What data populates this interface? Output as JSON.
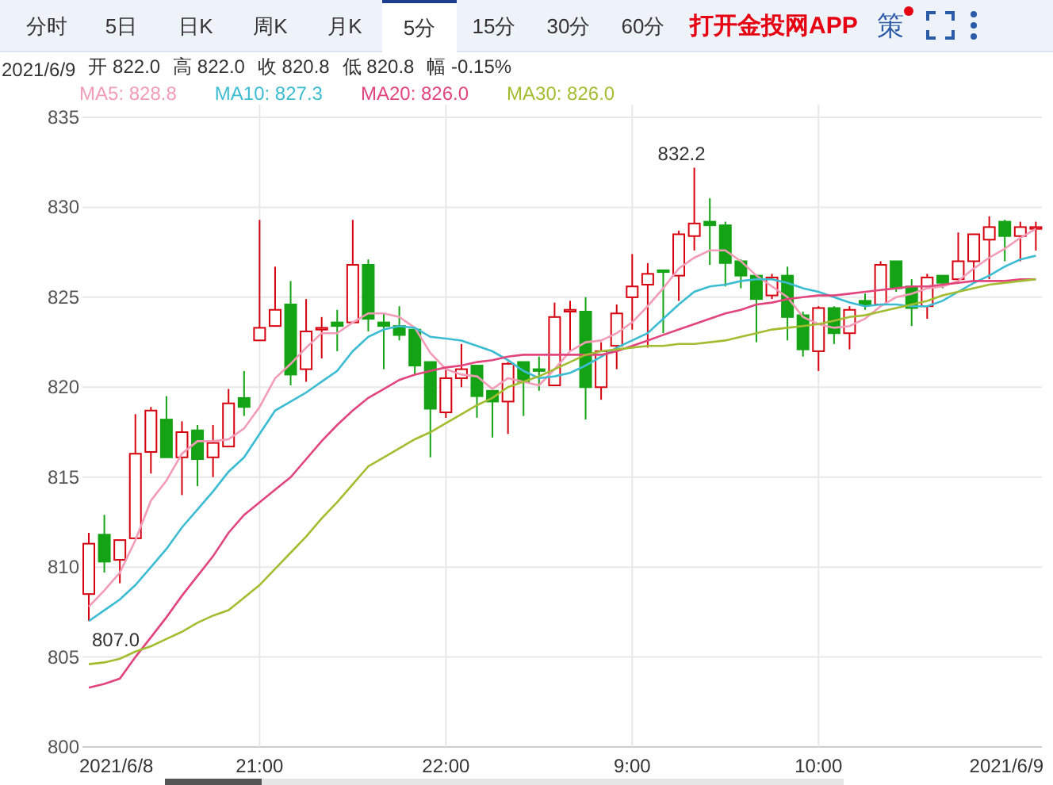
{
  "tabs": [
    {
      "label": "分时",
      "selected": false
    },
    {
      "label": "5日",
      "selected": false
    },
    {
      "label": "日K",
      "selected": false
    },
    {
      "label": "周K",
      "selected": false
    },
    {
      "label": "月K",
      "selected": false
    },
    {
      "label": "5分",
      "selected": true
    },
    {
      "label": "15分",
      "selected": false
    },
    {
      "label": "30分",
      "selected": false
    },
    {
      "label": "60分",
      "selected": false
    }
  ],
  "promo_link": "打开金投网APP",
  "strategy_button": {
    "label": "策",
    "has_alert": true
  },
  "quote_info": [
    "2021/6/9",
    "开 822.0",
    "高 822.0",
    "收 820.8",
    "低 820.8",
    "幅 -0.15%"
  ],
  "legend_values": [
    ": 828.8",
    ": 827.3",
    ": 826.0",
    ": 826.0"
  ],
  "axis_dates": [
    "2021/6/8",
    "2021/6/9"
  ],
  "chart_data": {
    "type": "candlestick",
    "grid": true,
    "categories": [
      null,
      null,
      null,
      null,
      null,
      null,
      null,
      null,
      null,
      null,
      null,
      "21:00",
      null,
      null,
      null,
      null,
      null,
      null,
      null,
      null,
      null,
      null,
      null,
      "22:00",
      null,
      null,
      null,
      null,
      null,
      null,
      null,
      null,
      null,
      null,
      null,
      "9:00",
      null,
      null,
      null,
      null,
      null,
      null,
      null,
      null,
      null,
      null,
      null,
      "10:00",
      null,
      null,
      null,
      null,
      null,
      null,
      null,
      null,
      null,
      null,
      null,
      null,
      null,
      null
    ],
    "ylim": [
      800,
      835
    ],
    "yticks": [
      800,
      805,
      810,
      815,
      820,
      825,
      830,
      835
    ],
    "annotations": [
      "832.2",
      "807.0"
    ],
    "ohlc": [
      [
        808.5,
        811.9,
        807.0,
        811.3
      ],
      [
        811.8,
        812.9,
        809.7,
        810.3
      ],
      [
        810.4,
        811.5,
        809.1,
        811.5
      ],
      [
        811.6,
        818.5,
        811.6,
        816.3
      ],
      [
        816.4,
        818.9,
        815.2,
        818.7
      ],
      [
        818.2,
        819.5,
        816.1,
        816.1
      ],
      [
        816.1,
        818.1,
        814.0,
        817.5
      ],
      [
        817.6,
        817.9,
        814.5,
        816.0
      ],
      [
        816.1,
        817.9,
        815.0,
        816.9
      ],
      [
        816.7,
        819.9,
        816.7,
        819.1
      ],
      [
        819.4,
        820.9,
        818.4,
        818.9
      ],
      [
        822.6,
        829.3,
        822.6,
        823.3
      ],
      [
        823.4,
        826.7,
        823.4,
        824.3
      ],
      [
        824.6,
        825.9,
        820.1,
        820.7
      ],
      [
        821.0,
        824.9,
        820.3,
        823.1
      ],
      [
        823.2,
        823.9,
        821.6,
        823.3
      ],
      [
        823.6,
        824.3,
        822.0,
        823.4
      ],
      [
        823.6,
        829.3,
        823.6,
        826.8
      ],
      [
        826.8,
        827.1,
        823.1,
        823.8
      ],
      [
        823.6,
        824.1,
        821.0,
        823.4
      ],
      [
        823.4,
        824.5,
        822.6,
        822.9
      ],
      [
        823.2,
        823.3,
        820.7,
        821.2
      ],
      [
        821.4,
        821.4,
        816.1,
        818.8
      ],
      [
        818.6,
        821.0,
        818.3,
        820.5
      ],
      [
        820.5,
        822.4,
        820.0,
        821.0
      ],
      [
        821.2,
        821.2,
        818.3,
        819.5
      ],
      [
        819.8,
        819.8,
        817.2,
        819.2
      ],
      [
        819.2,
        821.4,
        817.4,
        821.3
      ],
      [
        821.4,
        821.4,
        818.4,
        820.3
      ],
      [
        821.0,
        821.7,
        819.8,
        820.9
      ],
      [
        820.1,
        824.7,
        820.1,
        823.9
      ],
      [
        824.2,
        824.8,
        822.0,
        824.3
      ],
      [
        824.2,
        825.0,
        818.2,
        820.0
      ],
      [
        820.0,
        822.5,
        819.3,
        822.0
      ],
      [
        822.3,
        824.6,
        821.0,
        824.1
      ],
      [
        825.0,
        827.4,
        823.2,
        825.6
      ],
      [
        825.7,
        826.9,
        822.2,
        826.3
      ],
      [
        826.5,
        826.5,
        823.0,
        826.4
      ],
      [
        826.2,
        828.7,
        824.8,
        828.5
      ],
      [
        828.4,
        832.2,
        827.6,
        829.1
      ],
      [
        829.2,
        830.5,
        826.8,
        829.0
      ],
      [
        829.0,
        829.2,
        825.6,
        826.9
      ],
      [
        827.0,
        827.1,
        825.5,
        826.2
      ],
      [
        826.2,
        826.2,
        822.5,
        824.9
      ],
      [
        825.1,
        826.3,
        824.9,
        826.1
      ],
      [
        826.2,
        826.7,
        822.6,
        823.9
      ],
      [
        824.0,
        824.2,
        821.7,
        822.1
      ],
      [
        822.0,
        824.5,
        820.9,
        824.4
      ],
      [
        824.4,
        824.5,
        822.4,
        823.0
      ],
      [
        823.0,
        824.5,
        822.1,
        824.3
      ],
      [
        824.8,
        825.2,
        824.3,
        824.6
      ],
      [
        824.6,
        827.0,
        824.5,
        826.8
      ],
      [
        827.0,
        827.0,
        825.3,
        825.5
      ],
      [
        825.6,
        826.0,
        823.4,
        824.4
      ],
      [
        824.5,
        826.3,
        823.8,
        826.1
      ],
      [
        826.2,
        826.2,
        825.5,
        825.8
      ],
      [
        826.0,
        828.6,
        825.8,
        827.0
      ],
      [
        827.0,
        828.5,
        825.8,
        828.5
      ],
      [
        828.2,
        829.5,
        826.0,
        828.9
      ],
      [
        829.2,
        829.3,
        827.0,
        828.4
      ],
      [
        828.4,
        829.2,
        827.0,
        828.9
      ],
      [
        828.8,
        829.2,
        827.6,
        828.9
      ]
    ],
    "series": [
      {
        "name": "MA5",
        "type": "line",
        "color": "#f29cb7",
        "values": [
          807.8,
          808.7,
          809.7,
          811.5,
          813.7,
          814.8,
          816.3,
          817.0,
          817.0,
          817.1,
          817.7,
          818.9,
          820.5,
          821.3,
          822.2,
          823.0,
          823.0,
          823.6,
          824.1,
          824.1,
          823.9,
          823.3,
          821.9,
          821.0,
          820.7,
          820.6,
          819.9,
          820.5,
          820.3,
          820.1,
          821.0,
          822.0,
          822.5,
          822.6,
          823.0,
          823.6,
          824.5,
          825.5,
          826.6,
          827.2,
          827.6,
          827.6,
          827.0,
          826.2,
          825.6,
          825.0,
          823.9,
          823.5,
          823.3,
          823.4,
          823.8,
          824.5,
          825.0,
          825.2,
          825.5,
          825.6,
          825.9,
          826.6,
          827.2,
          827.7,
          828.3,
          828.8
        ]
      },
      {
        "name": "MA10",
        "type": "line",
        "color": "#3cbcd2",
        "values": [
          807.0,
          807.6,
          808.2,
          809.0,
          810.0,
          811.0,
          812.2,
          813.2,
          814.2,
          815.3,
          816.1,
          817.4,
          818.7,
          819.2,
          819.7,
          820.3,
          820.9,
          822.0,
          822.8,
          823.2,
          823.4,
          823.3,
          822.8,
          822.7,
          822.6,
          822.3,
          822.0,
          821.5,
          820.9,
          820.5,
          820.6,
          820.8,
          821.2,
          821.7,
          822.2,
          822.6,
          823.0,
          823.8,
          824.6,
          825.3,
          825.6,
          825.7,
          825.9,
          826.0,
          826.0,
          825.8,
          825.5,
          825.3,
          825.0,
          824.7,
          824.5,
          824.6,
          824.6,
          824.5,
          824.5,
          824.8,
          825.3,
          825.8,
          826.2,
          826.7,
          827.1,
          827.3
        ]
      },
      {
        "name": "MA20",
        "type": "line",
        "color": "#e2447c",
        "values": [
          803.3,
          803.5,
          803.8,
          805.0,
          806.1,
          807.2,
          808.4,
          809.5,
          810.6,
          811.9,
          812.9,
          813.6,
          814.3,
          815.0,
          816.0,
          817.0,
          817.9,
          818.7,
          819.4,
          819.9,
          820.4,
          820.7,
          820.9,
          821.1,
          821.2,
          821.4,
          821.5,
          821.7,
          821.8,
          821.8,
          821.8,
          821.8,
          821.8,
          821.8,
          822.0,
          822.3,
          822.6,
          822.9,
          823.2,
          823.5,
          823.8,
          824.1,
          824.3,
          824.6,
          824.7,
          824.9,
          825.0,
          825.1,
          825.1,
          825.2,
          825.3,
          825.4,
          825.5,
          825.6,
          825.6,
          825.7,
          825.8,
          825.9,
          825.9,
          825.9,
          826.0,
          826.0
        ]
      },
      {
        "name": "MA30",
        "type": "line",
        "color": "#a3bd31",
        "values": [
          804.6,
          804.7,
          804.9,
          805.3,
          805.6,
          806.0,
          806.4,
          806.9,
          807.3,
          807.6,
          808.3,
          809.0,
          809.9,
          810.8,
          811.7,
          812.7,
          813.6,
          814.6,
          815.6,
          816.1,
          816.6,
          817.1,
          817.5,
          818.0,
          818.5,
          819.0,
          819.4,
          820.0,
          820.3,
          820.6,
          821.0,
          821.4,
          821.8,
          822.0,
          822.1,
          822.2,
          822.3,
          822.3,
          822.4,
          822.4,
          822.5,
          822.6,
          822.8,
          823.0,
          823.2,
          823.3,
          823.4,
          823.5,
          823.7,
          823.9,
          824.0,
          824.2,
          824.4,
          824.6,
          824.8,
          825.1,
          825.3,
          825.5,
          825.7,
          825.8,
          825.9,
          826.0
        ]
      }
    ]
  }
}
